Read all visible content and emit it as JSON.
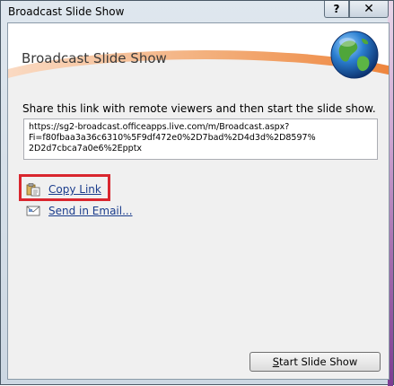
{
  "window": {
    "title": "Broadcast Slide Show",
    "help_label": "?",
    "close_label": "✕"
  },
  "banner": {
    "title": "Broadcast Slide Show",
    "icon": "globe-icon"
  },
  "instruction": "Share this link with remote viewers and then start the slide show.",
  "link_text": "https://sg2-broadcast.officeapps.live.com/m/Broadcast.aspx?\nFi=f80fbaa3a36c6310%5F9df472e0%2D7bad%2D4d3d%2D8597%\n2D2d7cbca7a0e6%2Epptx",
  "actions": {
    "copy_link": {
      "label": "Copy Link",
      "icon": "clipboard-icon"
    },
    "send_email": {
      "label": "Send in Email...",
      "icon": "envelope-icon"
    }
  },
  "buttons": {
    "start_first": "S",
    "start_rest": "tart Slide Show"
  },
  "colors": {
    "highlight": "#d9262e",
    "link": "#1a3c8c",
    "banner_orange": "#ec7a2c"
  }
}
